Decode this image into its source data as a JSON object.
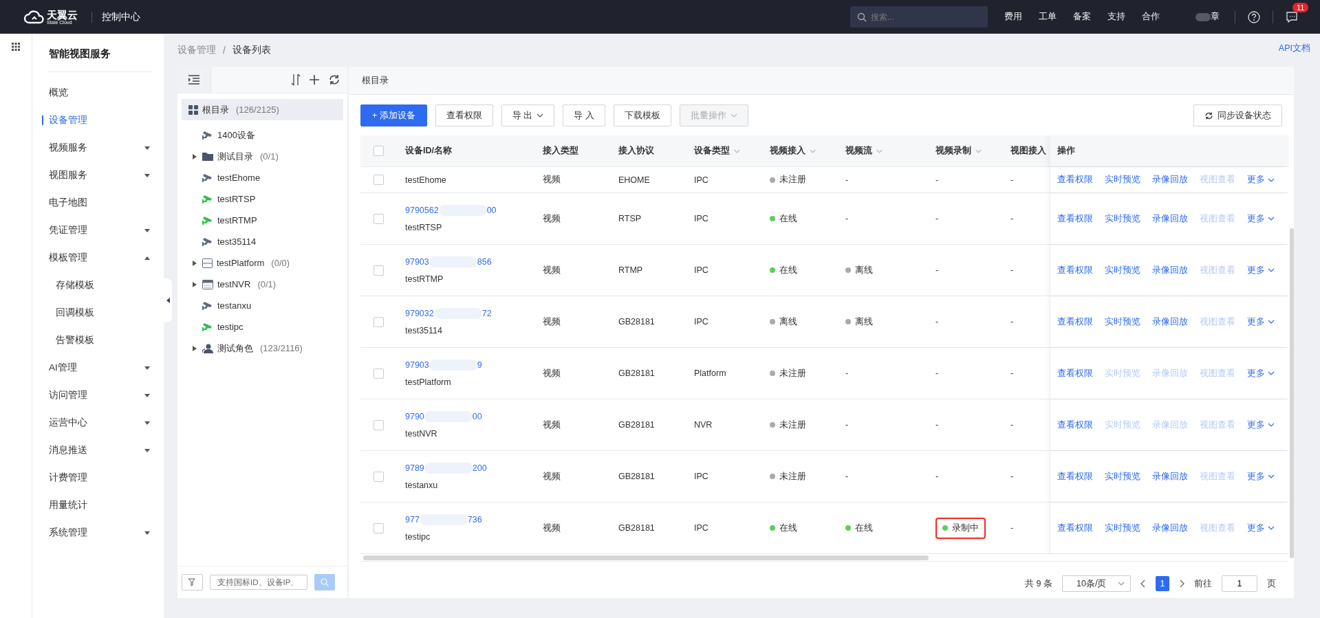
{
  "topbar": {
    "logo": {
      "name": "天翼云",
      "sub": "State Cloud"
    },
    "title": "控制中心",
    "search": {
      "placeholder": "搜索..."
    },
    "links": [
      "费用",
      "工单",
      "备案",
      "支持",
      "合作"
    ],
    "user": "章",
    "notifications": "11"
  },
  "sidebar": {
    "title": "智能视图服务",
    "items": [
      {
        "label": "概览",
        "selected": false
      },
      {
        "label": "设备管理",
        "selected": true
      },
      {
        "label": "视频服务",
        "selected": false,
        "expanded": false
      },
      {
        "label": "视图服务",
        "selected": false,
        "expanded": false
      },
      {
        "label": "电子地图",
        "selected": false
      },
      {
        "label": "凭证管理",
        "selected": false,
        "expanded": false
      },
      {
        "label": "模板管理",
        "selected": false,
        "expanded": true,
        "children": [
          {
            "label": "存储模板",
            "selected": false
          },
          {
            "label": "回调模板",
            "selected": false
          },
          {
            "label": "告警模板",
            "selected": false
          }
        ]
      },
      {
        "label": "AI管理",
        "selected": false,
        "expanded": false
      },
      {
        "label": "访问管理",
        "selected": false,
        "expanded": false
      },
      {
        "label": "运营中心",
        "selected": false,
        "expanded": false
      },
      {
        "label": "消息推送",
        "selected": false,
        "expanded": false
      },
      {
        "label": "计费管理",
        "selected": false
      },
      {
        "label": "用量统计",
        "selected": false
      },
      {
        "label": "系统管理",
        "selected": false,
        "expanded": false
      }
    ]
  },
  "breadcrumb": [
    "设备管理",
    "设备列表"
  ],
  "breadcrumb_separator": "/",
  "api_link": "API文档",
  "tree": {
    "root": {
      "kind": "root",
      "label": "根目录",
      "count": "(126/2125)",
      "selected": true,
      "children": [
        {
          "kind": "camera",
          "label": "1400设备",
          "online": false,
          "selected": false
        },
        {
          "kind": "folder",
          "label": "测试目录",
          "count": "(0/1)",
          "expanded": false,
          "selected": false
        },
        {
          "kind": "camera",
          "label": "testEhome",
          "online": false,
          "selected": false
        },
        {
          "kind": "camera",
          "label": "testRTSP",
          "online": true,
          "selected": false
        },
        {
          "kind": "camera",
          "label": "testRTMP",
          "online": true,
          "selected": false
        },
        {
          "kind": "camera",
          "label": "test35114",
          "online": false,
          "selected": false
        },
        {
          "kind": "platform",
          "label": "testPlatform",
          "count": "(0/0)",
          "expanded": false,
          "selected": false
        },
        {
          "kind": "nvr",
          "label": "testNVR",
          "count": "(0/1)",
          "expanded": false,
          "selected": false
        },
        {
          "kind": "camera",
          "label": "testanxu",
          "online": false,
          "selected": false
        },
        {
          "kind": "camera",
          "label": "testipc",
          "online": true,
          "selected": false
        },
        {
          "kind": "role",
          "label": "测试角色",
          "count": "(123/2116)",
          "expanded": false,
          "selected": false
        }
      ]
    },
    "search": {
      "placeholder": "支持国标ID、设备IP、"
    }
  },
  "panel_title": "根目录",
  "toolbar": [
    {
      "label": "+ 添加设备",
      "kind": "primary",
      "disabled": false
    },
    {
      "label": "查看权限",
      "kind": "plain",
      "disabled": false
    },
    {
      "label": "导 出",
      "kind": "dropdown",
      "disabled": false
    },
    {
      "label": "导 入",
      "kind": "plain",
      "disabled": false
    },
    {
      "label": "下载模板",
      "kind": "plain",
      "disabled": false
    },
    {
      "label": "批量操作",
      "kind": "dropdown",
      "disabled": true
    }
  ],
  "sync_button": "同步设备状态",
  "table": {
    "select_all_checked": false,
    "columns": [
      {
        "label": "设备ID/名称",
        "filter": false
      },
      {
        "label": "接入类型",
        "filter": false
      },
      {
        "label": "接入协议",
        "filter": false
      },
      {
        "label": "设备类型",
        "filter": true
      },
      {
        "label": "视频接入",
        "filter": true
      },
      {
        "label": "视频流",
        "filter": true
      },
      {
        "label": "视频录制",
        "filter": true
      },
      {
        "label": "视图接入"
      },
      {
        "label": "操作",
        "filter": false
      }
    ],
    "rows": [
      {
        "checked": false,
        "name": "testEhome",
        "access_type": "视频",
        "protocol": "EHOME",
        "device_type": "IPC",
        "video_access": {
          "text": "未注册",
          "color": "#aaaaaa"
        },
        "video_stream": {
          "text": "-"
        },
        "video_record": {
          "text": "-",
          "highlighted": false
        },
        "view_access": "-",
        "actions": [
          {
            "label": "查看权限",
            "disabled": false
          },
          {
            "label": "实时预览",
            "disabled": false
          },
          {
            "label": "录像回放",
            "disabled": false
          },
          {
            "label": "视图查看",
            "disabled": true
          },
          {
            "label": "更多",
            "disabled": false
          }
        ]
      },
      {
        "checked": false,
        "id_start": "9790562",
        "id_end": "00",
        "name": "testRTSP",
        "access_type": "视频",
        "protocol": "RTSP",
        "device_type": "IPC",
        "video_access": {
          "text": "在线",
          "color": "#5ccf5c"
        },
        "video_stream": {
          "text": "-"
        },
        "video_record": {
          "text": "-",
          "highlighted": false
        },
        "view_access": "-",
        "actions": [
          {
            "label": "查看权限",
            "disabled": false
          },
          {
            "label": "实时预览",
            "disabled": false
          },
          {
            "label": "录像回放",
            "disabled": false
          },
          {
            "label": "视图查看",
            "disabled": true
          },
          {
            "label": "更多",
            "disabled": false
          }
        ]
      },
      {
        "checked": false,
        "id_start": "97903",
        "id_end": "856",
        "name": "testRTMP",
        "access_type": "视频",
        "protocol": "RTMP",
        "device_type": "IPC",
        "video_access": {
          "text": "在线",
          "color": "#5ccf5c"
        },
        "video_stream": {
          "text": "离线",
          "color": "#aaaaaa"
        },
        "video_record": {
          "text": "-",
          "highlighted": false
        },
        "view_access": "-",
        "actions": [
          {
            "label": "查看权限",
            "disabled": false
          },
          {
            "label": "实时预览",
            "disabled": false
          },
          {
            "label": "录像回放",
            "disabled": false
          },
          {
            "label": "视图查看",
            "disabled": true
          },
          {
            "label": "更多",
            "disabled": false
          }
        ]
      },
      {
        "checked": false,
        "id_start": "979032",
        "id_end": "72",
        "name": "test35114",
        "access_type": "视频",
        "protocol": "GB28181",
        "device_type": "IPC",
        "video_access": {
          "text": "离线",
          "color": "#aaaaaa"
        },
        "video_stream": {
          "text": "离线",
          "color": "#aaaaaa"
        },
        "video_record": {
          "text": "-",
          "highlighted": false
        },
        "view_access": "-",
        "actions": [
          {
            "label": "查看权限",
            "disabled": false
          },
          {
            "label": "实时预览",
            "disabled": false
          },
          {
            "label": "录像回放",
            "disabled": false
          },
          {
            "label": "视图查看",
            "disabled": true
          },
          {
            "label": "更多",
            "disabled": false
          }
        ]
      },
      {
        "checked": false,
        "id_start": "97903",
        "id_end": "9",
        "name": "testPlatform",
        "access_type": "视频",
        "protocol": "GB28181",
        "device_type": "Platform",
        "video_access": {
          "text": "未注册",
          "color": "#aaaaaa"
        },
        "video_stream": {
          "text": "-"
        },
        "video_record": {
          "text": "-",
          "highlighted": false
        },
        "view_access": "-",
        "actions": [
          {
            "label": "查看权限",
            "disabled": false
          },
          {
            "label": "实时预览",
            "disabled": true
          },
          {
            "label": "录像回放",
            "disabled": true
          },
          {
            "label": "视图查看",
            "disabled": true
          },
          {
            "label": "更多",
            "disabled": false
          }
        ]
      },
      {
        "checked": false,
        "id_start": "9790",
        "id_end": "00",
        "name": "testNVR",
        "access_type": "视频",
        "protocol": "GB28181",
        "device_type": "NVR",
        "video_access": {
          "text": "未注册",
          "color": "#aaaaaa"
        },
        "video_stream": {
          "text": "-"
        },
        "video_record": {
          "text": "-",
          "highlighted": false
        },
        "view_access": "-",
        "actions": [
          {
            "label": "查看权限",
            "disabled": false
          },
          {
            "label": "实时预览",
            "disabled": true
          },
          {
            "label": "录像回放",
            "disabled": true
          },
          {
            "label": "视图查看",
            "disabled": true
          },
          {
            "label": "更多",
            "disabled": false
          }
        ]
      },
      {
        "checked": false,
        "id_start": "9789",
        "id_end": "200",
        "name": "testanxu",
        "access_type": "视频",
        "protocol": "GB28181",
        "device_type": "IPC",
        "video_access": {
          "text": "未注册",
          "color": "#aaaaaa"
        },
        "video_stream": {
          "text": "-"
        },
        "video_record": {
          "text": "-",
          "highlighted": false
        },
        "view_access": "-",
        "actions": [
          {
            "label": "查看权限",
            "disabled": false
          },
          {
            "label": "实时预览",
            "disabled": false
          },
          {
            "label": "录像回放",
            "disabled": false
          },
          {
            "label": "视图查看",
            "disabled": true
          },
          {
            "label": "更多",
            "disabled": false
          }
        ]
      },
      {
        "checked": false,
        "id_start": "977",
        "id_end": "736",
        "name": "testipc",
        "access_type": "视频",
        "protocol": "GB28181",
        "device_type": "IPC",
        "video_access": {
          "text": "在线",
          "color": "#5ccf5c"
        },
        "video_stream": {
          "text": "在线",
          "color": "#5ccf5c"
        },
        "video_record": {
          "text": "录制中",
          "color": "#5ccf5c",
          "highlighted": true
        },
        "view_access": "-",
        "actions": [
          {
            "label": "查看权限",
            "disabled": false
          },
          {
            "label": "实时预览",
            "disabled": false
          },
          {
            "label": "录像回放",
            "disabled": false
          },
          {
            "label": "视图查看",
            "disabled": true
          },
          {
            "label": "更多",
            "disabled": false
          }
        ]
      }
    ]
  },
  "pagination": {
    "total": "共 9 条",
    "page_size": "10条/页",
    "pages": [
      {
        "label": "1",
        "selected": true
      }
    ],
    "goto_label": "前往",
    "goto_value": "1",
    "goto_suffix": "页"
  }
}
